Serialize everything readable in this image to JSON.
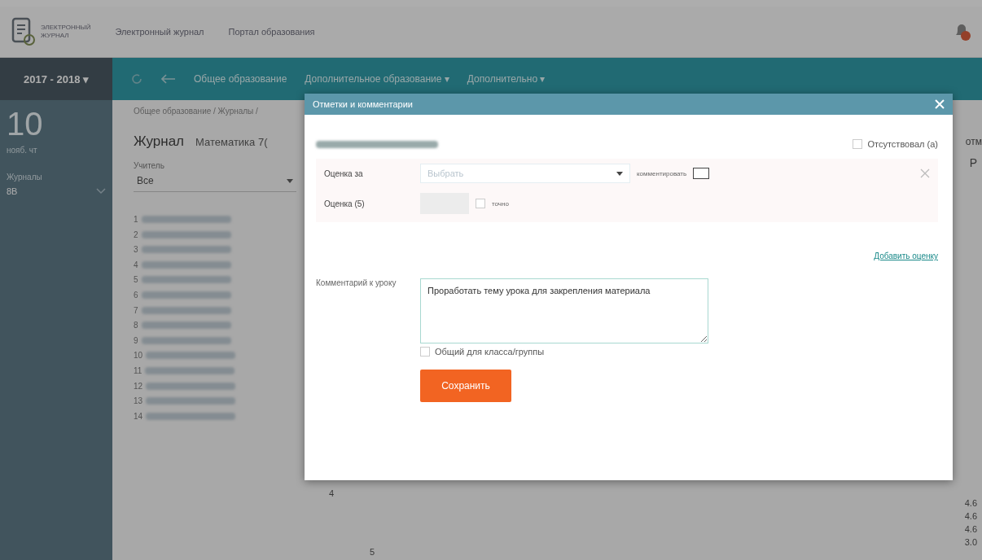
{
  "header": {
    "logo_lines": [
      "ЭЛЕКТРОННЫЙ",
      "ЖУРНАЛ"
    ],
    "links": [
      "Электронный журнал",
      "Портал образования"
    ],
    "notification_badge": true
  },
  "navbar": {
    "year": "2017 - 2018 ▾",
    "items": [
      "Общее образование",
      "Дополнительное образование ▾",
      "Дополнительно ▾"
    ]
  },
  "sidebar": {
    "day": "10",
    "month": "нояб. чт",
    "section": "Журналы",
    "class": "8В"
  },
  "breadcrumb": "Общее образование / Журналы / ",
  "page": {
    "title": "Журнал",
    "subject": "Математика 7(",
    "teacher_label": "Учитель",
    "teacher_value": "Все",
    "student_numbers": [
      "1",
      "2",
      "3",
      "4",
      "5",
      "6",
      "7",
      "8",
      "9",
      "10",
      "11",
      "12",
      "13",
      "14"
    ],
    "right_peek": [
      "отм",
      "Р"
    ],
    "bottom_cells": [
      "4",
      "5"
    ],
    "right_scores": [
      "4.6",
      "4.6",
      "4.6",
      "3.0"
    ]
  },
  "modal": {
    "title": "Отметки и комментарии",
    "absent": {
      "label": "Отсутствовал (а)",
      "checked": false
    },
    "grade_rows": [
      {
        "kind": "select",
        "label": "Оценка за",
        "placeholder": "Выбрать",
        "extra": "комментировать",
        "checked": false
      },
      {
        "kind": "value",
        "label": "Оценка (5)",
        "extra": "точно",
        "checked": false
      }
    ],
    "add_grade": "Добавить оценку",
    "comment_label": "Комментарий к уроку",
    "comment": "Проработать тему урока для закрепления материала",
    "shared": {
      "label": "Общий для класса/группы",
      "checked": false
    },
    "save": "Сохранить"
  }
}
